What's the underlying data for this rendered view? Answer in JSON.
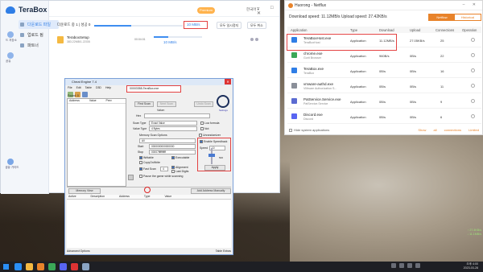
{
  "terabox": {
    "app_name": "TeraBox",
    "nav": [
      {
        "label": "다운로드 파일",
        "active": true
      },
      {
        "label": "업로드 됨",
        "active": false
      },
      {
        "label": "파트너",
        "active": false
      }
    ],
    "side_labels": [
      "드 저장소",
      "공유"
    ],
    "bottom_label": "공유 가이드",
    "premium": "Premium",
    "language": "한국어 ▾",
    "status_text": "다운로드 중 1 | 성공 0",
    "status_progress": 0.42,
    "speed_box": "10 MB/s",
    "btn_pause_all": "모두 일시정지",
    "btn_cancel_all": "모두 취소",
    "file": {
      "name": "TeraboxSetup",
      "size": "383.22MB/1.22GB",
      "time": "00:04:01",
      "speed": "10 MB/s",
      "progress": 0.3
    }
  },
  "cheat_engine": {
    "title": "Cheat Engine 7.4",
    "menu": [
      "File",
      "Edit",
      "Table",
      "D3D",
      "Help"
    ],
    "process": "00003358-TeraBox.exe",
    "found": "Found: 0",
    "list_headers": [
      "Address",
      "Value",
      "Prev"
    ],
    "btn_first_scan": "First Scan",
    "btn_next_scan": "Next Scan",
    "btn_undo_scan": "Undo Scan",
    "value_label": "Value:",
    "hex_label": "Hex",
    "scan_type_label": "Scan Type",
    "scan_type_value": "Exact Value",
    "value_type_label": "Value Type",
    "value_type_value": "4 Bytes",
    "lua_formula": "Lua formula",
    "not_label": "Not",
    "memory_scan_options": "Memory Scan Options",
    "all_label": "All",
    "start_label": "Start",
    "start_value": "0000000000000000",
    "stop_label": "Stop",
    "stop_value": "00007fffffffffff",
    "writable": "Writable",
    "executable": "Executable",
    "copy_on_write": "CopyOnWrite",
    "fast_scan": "Fast Scan",
    "fast_scan_value": "4",
    "alignment": "Alignment",
    "last_digits": "Last Digits",
    "pause_game": "Pause the game while scanning",
    "unrandomizer": "Unrandomizer",
    "enable_speedhack": "Enable Speedhack",
    "speed_label": "Speed",
    "speed_value": "10",
    "slider_max": "500",
    "btn_apply": "Apply",
    "settings": "Settings",
    "btn_memory_view": "Memory View",
    "btn_add_address": "Add Address Manually",
    "lower_headers": [
      "Active",
      "Description",
      "Address",
      "Type",
      "Value"
    ],
    "advanced_options": "Advanced Options",
    "table_extras": "Table Extras"
  },
  "huorong": {
    "title": "Huorong - Netflux",
    "speeds": "Download speed: 11.12MB/s  Upload speed: 27.42KB/s",
    "tab_on": "Netflow",
    "tab_off": "Historical",
    "headers": [
      "Application",
      "Type",
      "Download",
      "Upload",
      "Connections",
      "Operation"
    ],
    "rows": [
      {
        "name": "TeraBoxHost.exe",
        "sub": "TeraBoxHost",
        "type": "Application",
        "down": "11.12MB/s",
        "up": "27.05KB/s",
        "conn": "25",
        "color": "#2f7ee6"
      },
      {
        "name": "chrome.exe",
        "sub": "Gorit Browser",
        "type": "Application",
        "down": "960B/s",
        "up": "0B/s",
        "conn": "22",
        "color": "#3aa757"
      },
      {
        "name": "TeraBox.exe",
        "sub": "TeraBox",
        "type": "Application",
        "down": "0B/s",
        "up": "0B/s",
        "conn": "16",
        "color": "#2f7ee6"
      },
      {
        "name": "vmware-authd.exe",
        "sub": "VMware Authorization S...",
        "type": "Application",
        "down": "0B/s",
        "up": "0B/s",
        "conn": "11",
        "color": "#8a8f99"
      },
      {
        "name": "PatService.Service.exe",
        "sub": "PatService.Service",
        "type": "Application",
        "down": "0B/s",
        "up": "0B/s",
        "conn": "9",
        "color": "#5b6bd1"
      },
      {
        "name": "Discord.exe",
        "sub": "Discord",
        "type": "Application",
        "down": "0B/s",
        "up": "0B/s",
        "conn": "6",
        "color": "#5865f2"
      }
    ],
    "hide_system": "Hide system applications",
    "link_show_all": "Show all connections",
    "link_limited": "Limited"
  },
  "netinfo": [
    "↑ 27.4KB/s",
    "↓ 11.1MB/s"
  ],
  "clock": {
    "time": "오후 4:00",
    "date": "2023-03-28"
  },
  "colors": {
    "accent_blue": "#2f7ee6",
    "highlight_red": "#e34242",
    "huorong_orange": "#e8832a",
    "taskbar": "#1e1f24"
  },
  "taskbar_apps": [
    "#2a8ff7",
    "#f5b941",
    "#e8832a",
    "#3aa757",
    "#5865f2",
    "#d33",
    "#8aa3c2"
  ]
}
